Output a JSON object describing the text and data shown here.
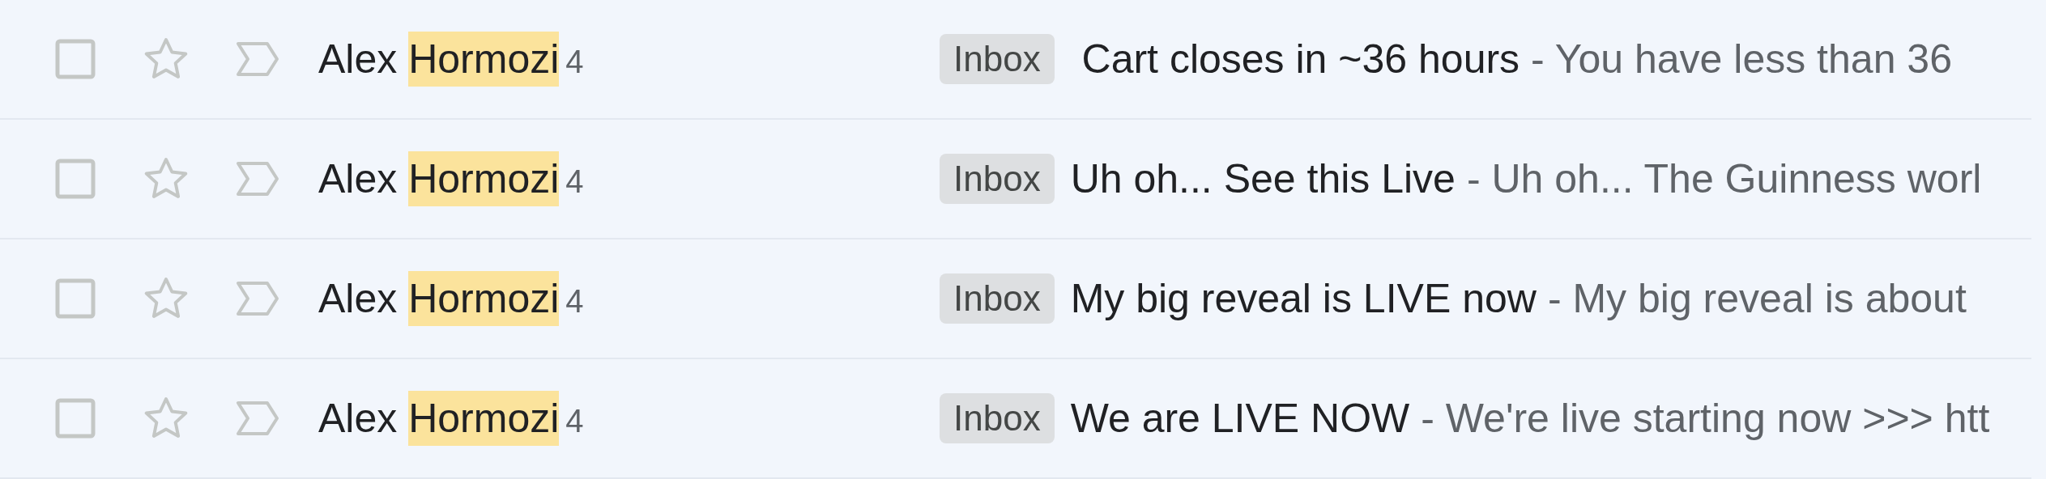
{
  "messages": [
    {
      "checked": false,
      "starred": false,
      "important": false,
      "sender_parts": [
        {
          "text": "Alex",
          "highlighted": false
        },
        {
          "text": "Hormozi",
          "highlighted": true
        }
      ],
      "count": "4",
      "label": "Inbox",
      "subject": " Cart closes in ~36 hours",
      "snippet": "- You have less than 36"
    },
    {
      "checked": false,
      "starred": false,
      "important": false,
      "sender_parts": [
        {
          "text": "Alex",
          "highlighted": false
        },
        {
          "text": "Hormozi",
          "highlighted": true
        }
      ],
      "count": "4",
      "label": "Inbox",
      "subject": "Uh oh... See this Live",
      "snippet": "- Uh oh... The Guinness worl"
    },
    {
      "checked": false,
      "starred": false,
      "important": false,
      "sender_parts": [
        {
          "text": "Alex",
          "highlighted": false
        },
        {
          "text": "Hormozi",
          "highlighted": true
        }
      ],
      "count": "4",
      "label": "Inbox",
      "subject": "My big reveal is LIVE now",
      "snippet": "- My big reveal is about"
    },
    {
      "checked": false,
      "starred": false,
      "important": false,
      "sender_parts": [
        {
          "text": "Alex",
          "highlighted": false
        },
        {
          "text": "Hormozi",
          "highlighted": true
        }
      ],
      "count": "4",
      "label": "Inbox",
      "subject": "We are LIVE NOW",
      "snippet": "- We're live starting now >>> htt"
    }
  ]
}
